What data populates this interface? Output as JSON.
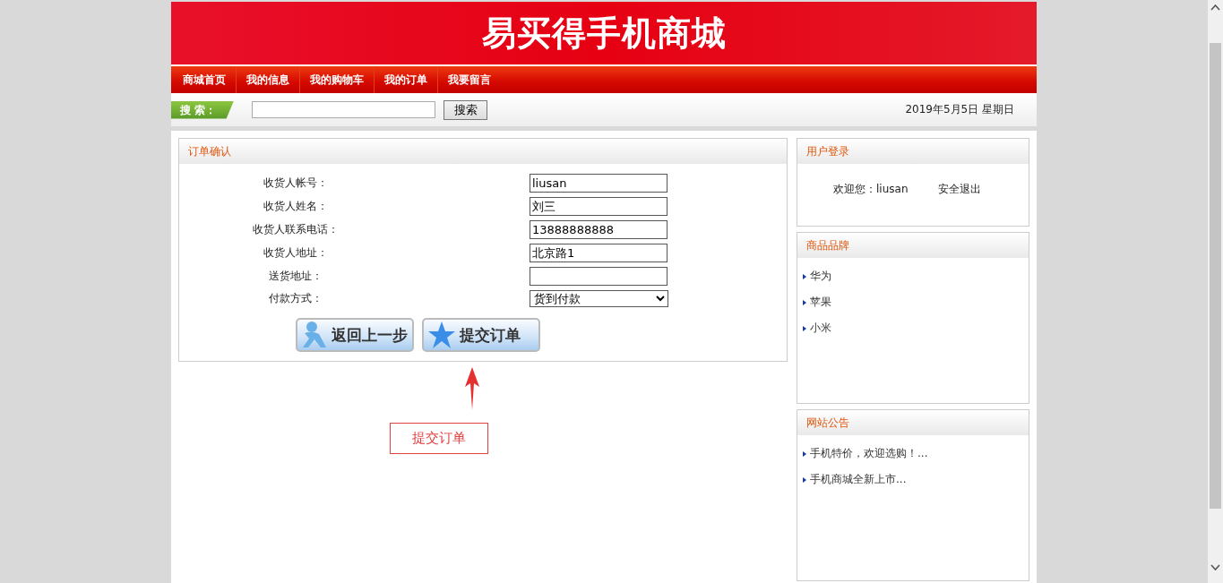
{
  "header": {
    "title": "易买得手机商城"
  },
  "nav": [
    {
      "label": "商城首页"
    },
    {
      "label": "我的信息"
    },
    {
      "label": "我的购物车"
    },
    {
      "label": "我的订单"
    },
    {
      "label": "我要留言"
    }
  ],
  "search": {
    "label": "搜 索：",
    "button": "搜索"
  },
  "date": "2019年5月5日 星期日",
  "order_panel": {
    "title": "订单确认",
    "fields": [
      {
        "kind": "text",
        "label": "收货人帐号：",
        "value": "liusan"
      },
      {
        "kind": "text",
        "label": "收货人姓名：",
        "value": "刘三"
      },
      {
        "kind": "text",
        "label": "收货人联系电话：",
        "value": "13888888888"
      },
      {
        "kind": "text",
        "label": "收货人地址：",
        "value": "北京路1"
      },
      {
        "kind": "text",
        "label": "送货地址："
      },
      {
        "kind": "select",
        "label": "付款方式：",
        "value": "货到付款"
      }
    ],
    "buttons": [
      {
        "kind": "back",
        "label": "返回上一步"
      },
      {
        "kind": "submit",
        "label": "提交订单"
      }
    ]
  },
  "annotation": {
    "text": "提交订单"
  },
  "sidebar": {
    "login": {
      "title": "用户登录",
      "welcome": "欢迎您：liusan",
      "logout": "安全退出"
    },
    "brands": {
      "title": "商品品牌",
      "items": [
        "华为",
        "苹果",
        "小米"
      ]
    },
    "notices": {
      "title": "网站公告",
      "items": [
        "手机特价，欢迎选购！...",
        "手机商城全新上市..."
      ]
    }
  }
}
